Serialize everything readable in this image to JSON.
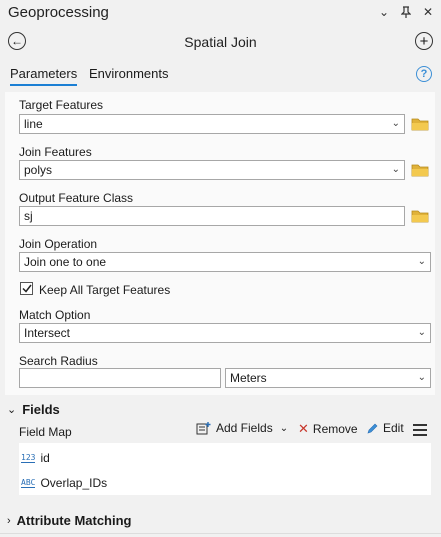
{
  "pane": {
    "title": "Geoprocessing",
    "tool_title": "Spatial Join"
  },
  "tabs": [
    {
      "label": "Parameters",
      "active": true
    },
    {
      "label": "Environments",
      "active": false
    }
  ],
  "params": {
    "target_features": {
      "label": "Target Features",
      "value": "line"
    },
    "join_features": {
      "label": "Join Features",
      "value": "polys"
    },
    "output_feature_class": {
      "label": "Output Feature Class",
      "value": "sj"
    },
    "join_operation": {
      "label": "Join Operation",
      "value": "Join one to one"
    },
    "keep_all": {
      "label": "Keep All Target Features",
      "checked": true
    },
    "match_option": {
      "label": "Match Option",
      "value": "Intersect"
    },
    "search_radius": {
      "label": "Search Radius",
      "value": "",
      "unit": "Meters"
    }
  },
  "fields_section": {
    "title": "Fields",
    "field_map_label": "Field Map",
    "add_fields_label": "Add Fields",
    "remove_label": "Remove",
    "edit_label": "Edit",
    "items": [
      {
        "type_badge": "123",
        "name": "id"
      },
      {
        "type_badge": "ABC",
        "name": "Overlap_IDs"
      }
    ]
  },
  "attribute_matching": {
    "title": "Attribute Matching"
  },
  "colors": {
    "accent": "#1b7fd4",
    "folder": "#e0b23a",
    "remove": "#c7362b",
    "help": "#3c8fd6"
  }
}
